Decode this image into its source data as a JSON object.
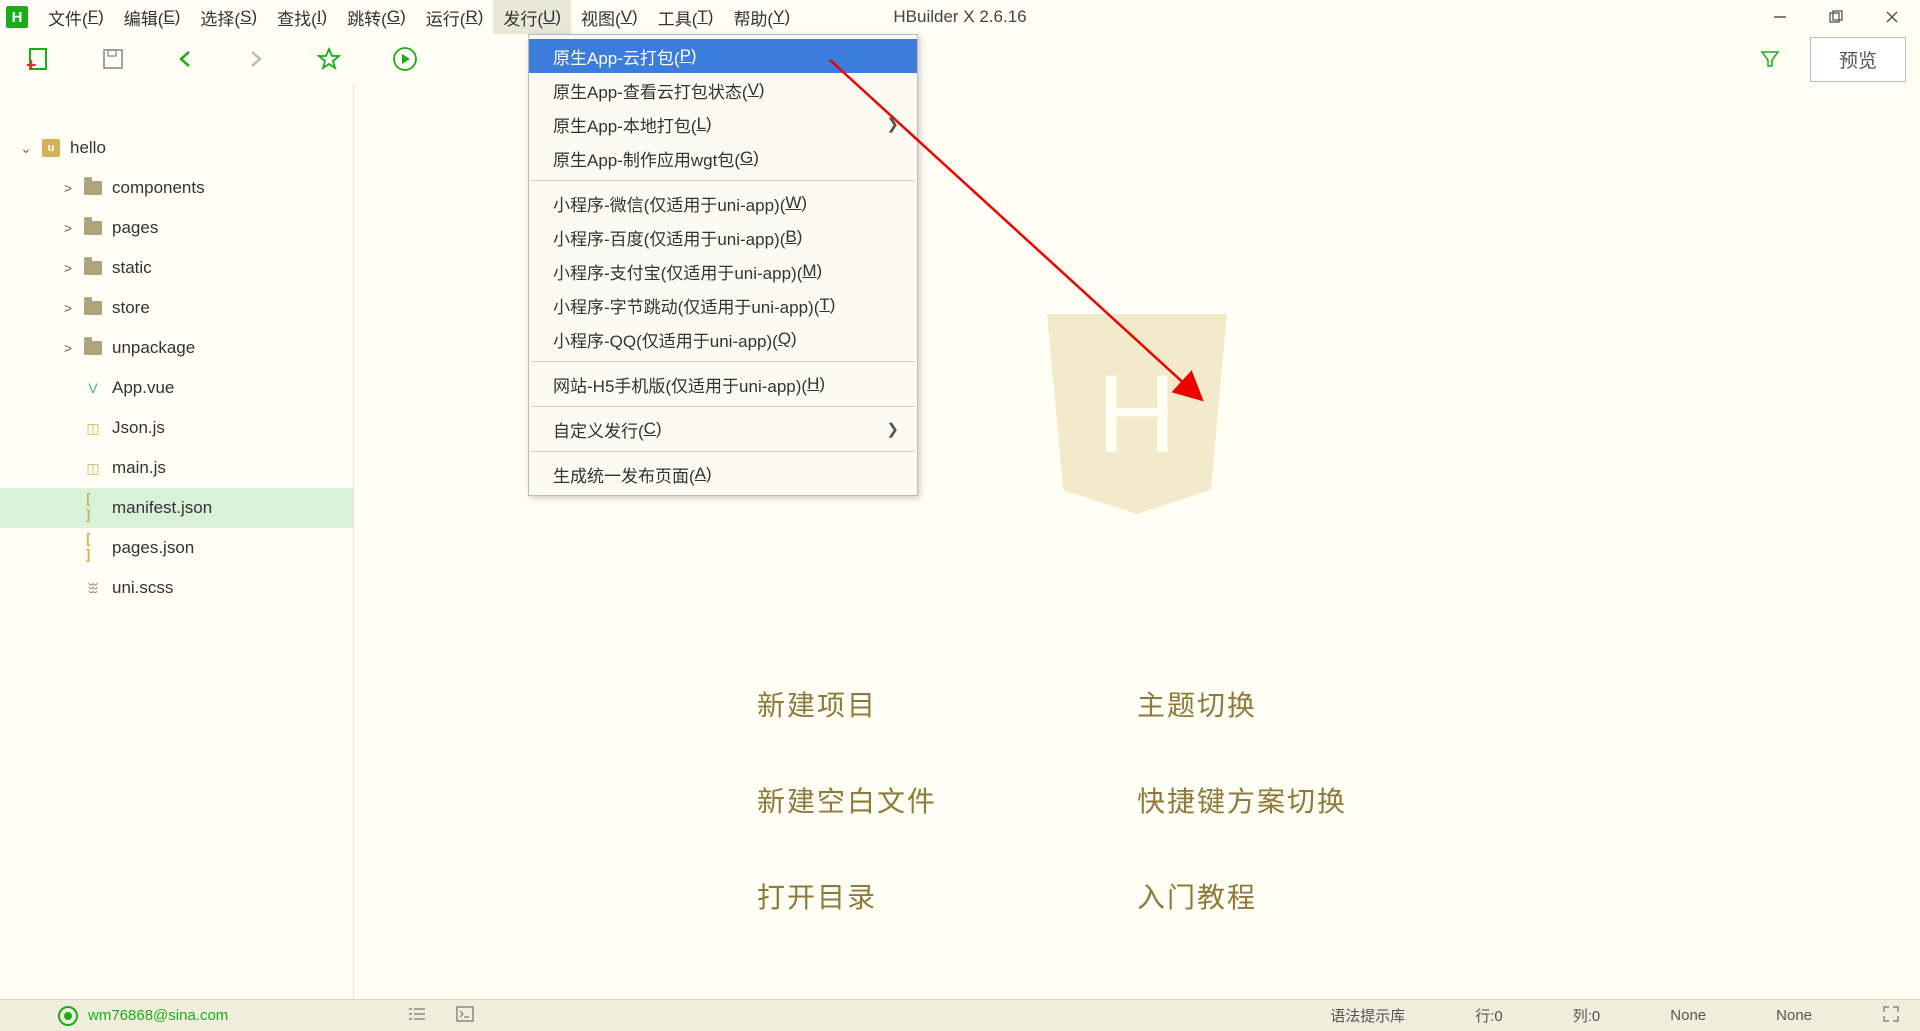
{
  "app": {
    "title": "HBuilder X 2.6.16"
  },
  "menubar": [
    {
      "label": "文件(F)",
      "key": "F"
    },
    {
      "label": "编辑(E)",
      "key": "E"
    },
    {
      "label": "选择(S)",
      "key": "S"
    },
    {
      "label": "查找(I)",
      "key": "I"
    },
    {
      "label": "跳转(G)",
      "key": "G"
    },
    {
      "label": "运行(R)",
      "key": "R"
    },
    {
      "label": "发行(U)",
      "key": "U",
      "open": true
    },
    {
      "label": "视图(V)",
      "key": "V"
    },
    {
      "label": "工具(T)",
      "key": "T"
    },
    {
      "label": "帮助(Y)",
      "key": "Y"
    }
  ],
  "toolbar": {
    "preview_label": "预览"
  },
  "dropdown": {
    "groups": [
      [
        {
          "label": "原生App-云打包(P)",
          "selected": true
        },
        {
          "label": "原生App-查看云打包状态(V)"
        },
        {
          "label": "原生App-本地打包(L)",
          "submenu": true
        },
        {
          "label": "原生App-制作应用wgt包(G)"
        }
      ],
      [
        {
          "label": "小程序-微信(仅适用于uni-app)(W)"
        },
        {
          "label": "小程序-百度(仅适用于uni-app)(B)"
        },
        {
          "label": "小程序-支付宝(仅适用于uni-app)(M)"
        },
        {
          "label": "小程序-字节跳动(仅适用于uni-app)(T)"
        },
        {
          "label": "小程序-QQ(仅适用于uni-app)(Q)"
        }
      ],
      [
        {
          "label": "网站-H5手机版(仅适用于uni-app)(H)"
        }
      ],
      [
        {
          "label": "自定义发行(C)",
          "submenu": true
        }
      ],
      [
        {
          "label": "生成统一发布页面(A)"
        }
      ]
    ]
  },
  "sidebar": {
    "project": "hello",
    "items": [
      {
        "type": "folder",
        "name": "components",
        "indent": 1,
        "chev": ">"
      },
      {
        "type": "folder",
        "name": "pages",
        "indent": 1,
        "chev": ">"
      },
      {
        "type": "folder",
        "name": "static",
        "indent": 1,
        "chev": ">"
      },
      {
        "type": "folder",
        "name": "store",
        "indent": 1,
        "chev": ">"
      },
      {
        "type": "folder",
        "name": "unpackage",
        "indent": 1,
        "chev": ">"
      },
      {
        "type": "file",
        "name": "App.vue",
        "icon": "vue",
        "indent": 1
      },
      {
        "type": "file",
        "name": "Json.js",
        "icon": "js",
        "indent": 1
      },
      {
        "type": "file",
        "name": "main.js",
        "icon": "js",
        "indent": 1
      },
      {
        "type": "file",
        "name": "manifest.json",
        "icon": "json",
        "indent": 1,
        "selected": true
      },
      {
        "type": "file",
        "name": "pages.json",
        "icon": "json",
        "indent": 1
      },
      {
        "type": "file",
        "name": "uni.scss",
        "icon": "scss",
        "indent": 1
      }
    ]
  },
  "welcome": {
    "links": [
      {
        "label": "新建项目"
      },
      {
        "label": "主题切换"
      },
      {
        "label": "新建空白文件"
      },
      {
        "label": "快捷键方案切换"
      },
      {
        "label": "打开目录"
      },
      {
        "label": "入门教程"
      }
    ]
  },
  "statusbar": {
    "user": "wm76868@sina.com",
    "syntax": "语法提示库",
    "line": "行:0",
    "col": "列:0",
    "enc": "None",
    "lang": "None"
  }
}
